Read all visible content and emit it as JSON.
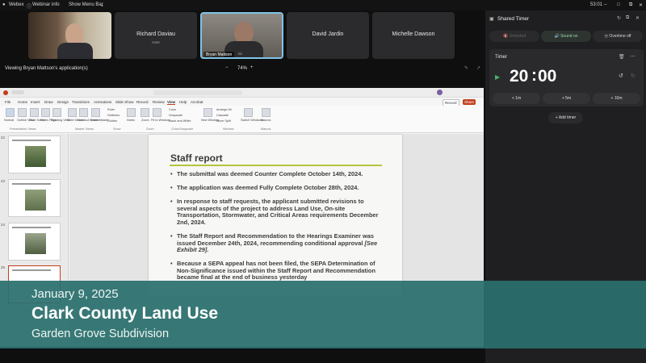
{
  "topbar": {
    "app_name": "Webex",
    "webinar_info": "Webinar info",
    "show_menu_bar": "Show Menu Bar",
    "clock": "53:01"
  },
  "participants": [
    {
      "name": "",
      "role": ""
    },
    {
      "name": "Richard Daviau",
      "role": "Host"
    },
    {
      "name": "Bryan Mattson",
      "role": ""
    },
    {
      "name": "David Jardin",
      "role": ""
    },
    {
      "name": "Michelle Dawson",
      "role": ""
    }
  ],
  "share_bar": {
    "label": "Viewing Bryan Mattson's application(s)",
    "zoom_minus": "−",
    "zoom": "74%",
    "zoom_plus": "+"
  },
  "ppt": {
    "record_label": "Record",
    "share_label": "Share",
    "menu": [
      "File",
      "Home",
      "Insert",
      "Draw",
      "Design",
      "Transitions",
      "Animations",
      "Slide Show",
      "Record",
      "Review",
      "View",
      "Help",
      "Acrobat"
    ],
    "ribbon": {
      "buttons": [
        "Normal",
        "Outline View",
        "Slide Sorter",
        "Notes Page",
        "Reading View",
        "Slide Master",
        "Handout Master",
        "Notes Master",
        "Notes",
        "Zoom",
        "Fit to Window",
        "New Window",
        "Switch Windows",
        "Macros"
      ],
      "checks": [
        "Ruler",
        "Gridlines",
        "Guides"
      ],
      "color_options": [
        "Color",
        "Grayscale",
        "Black and White"
      ],
      "window_options": [
        "Arrange All",
        "Cascade",
        "Move Split"
      ],
      "groups": [
        "Presentation Views",
        "Master Views",
        "Show",
        "Zoom",
        "Color/Grayscale",
        "Window",
        "Macros"
      ]
    },
    "thumb_numbers": [
      "22",
      "23",
      "24",
      "25"
    ],
    "slide": {
      "title": "Staff report",
      "bullets": [
        "The submittal was deemed Counter Complete October 14th, 2024.",
        "The application was deemed Fully Complete October 28th, 2024.",
        "In response to staff requests, the applicant submitted revisions to several aspects of the project to address Land Use, On-site Transportation, Stormwater, and Critical Areas requirements December 2nd, 2024.",
        "The  Staff Report and Recommendation to the Hearings Examiner was issued December 24th, 2024, recommending conditional approval ",
        "Because a SEPA appeal has not been filed, the SEPA Determination of Non-Significance issued within the Staff Report and Recommendation became final at the end of business yesterday"
      ],
      "exhibit": "[See Exhibit 29]."
    }
  },
  "timer_panel": {
    "title": "Shared Timer",
    "unmuted": "Unmuted",
    "sound_on": "Sound on",
    "overtime_off": "Overtime off",
    "timer_label": "Timer",
    "minutes": "20",
    "colon": ":",
    "seconds": "00",
    "add_1m": "+ 1m",
    "add_5m": "+ 5m",
    "add_10m": "+ 10m",
    "add_timer": "+ Add timer"
  },
  "lower_third": {
    "date": "January 9, 2025",
    "title": "Clark County Land Use",
    "subtitle": "Garden Grove Subdivision"
  },
  "colors": {
    "lower_third_bg": "#2a706e",
    "accent_green": "#b6c53a",
    "active_speaker_border": "#7fc3e6",
    "sound_on_green": "#49b36a"
  }
}
